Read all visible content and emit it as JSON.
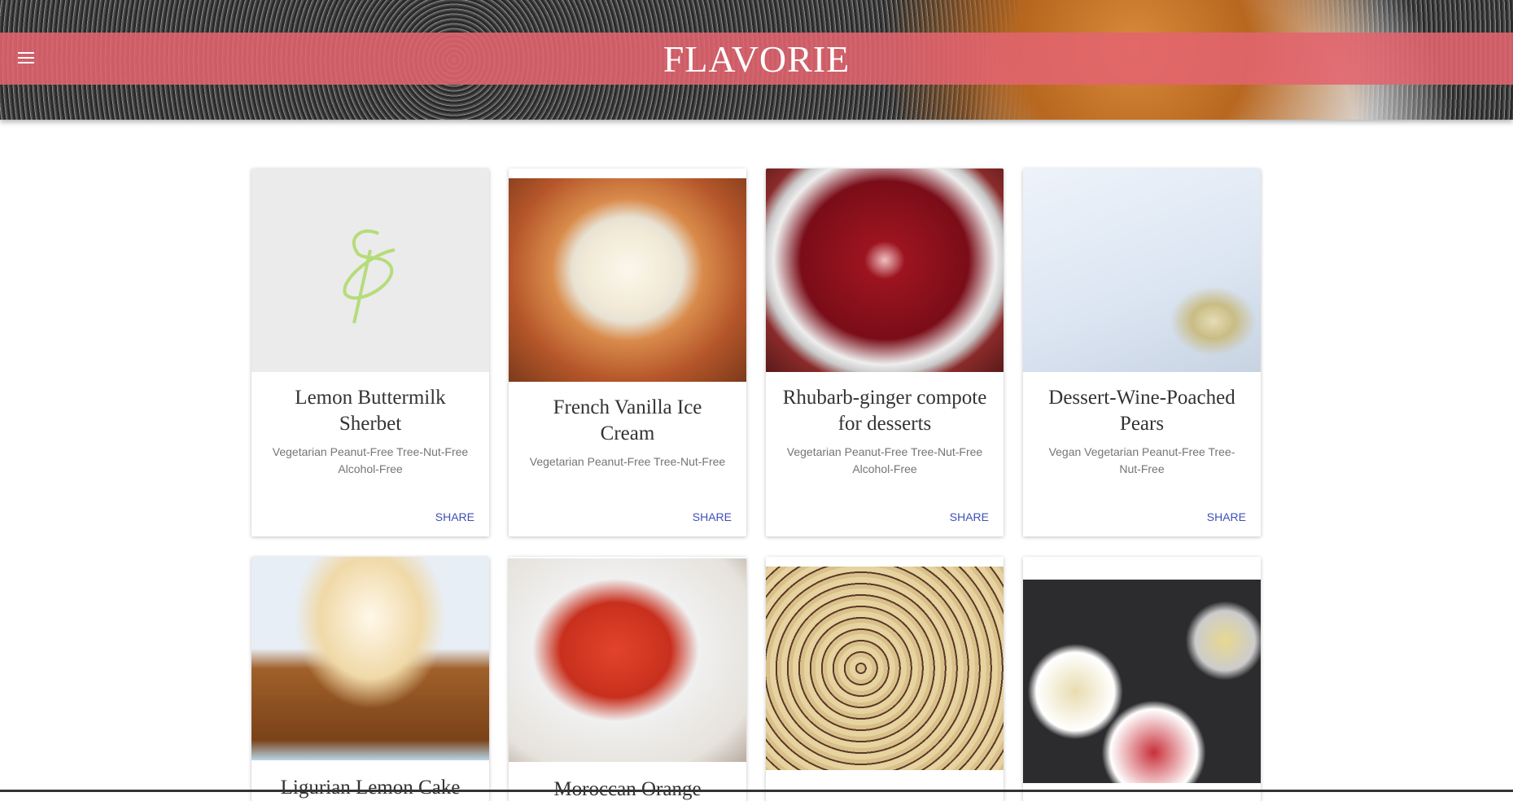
{
  "header": {
    "title": "FLAVORIE",
    "menu_icon": "hamburger-icon",
    "band_color": "#e2646e"
  },
  "share_label": "SHARE",
  "accent": "#3f51b5",
  "cards": [
    {
      "title": "Lemon Buttermilk Sherbet",
      "tags": "Vegetarian Peanut-Free Tree-Nut-Free Alcohol-Free"
    },
    {
      "title": "French Vanilla Ice Cream",
      "tags": "Vegetarian Peanut-Free Tree-Nut-Free"
    },
    {
      "title": "Rhubarb-ginger compote for desserts",
      "tags": "Vegetarian Peanut-Free Tree-Nut-Free Alcohol-Free"
    },
    {
      "title": "Dessert-Wine-Poached Pears",
      "tags": "Vegan Vegetarian Peanut-Free Tree-Nut-Free"
    },
    {
      "title": "Ligurian Lemon Cake"
    },
    {
      "title": "Moroccan Orange"
    },
    {
      "title": ""
    },
    {
      "title": ""
    }
  ]
}
